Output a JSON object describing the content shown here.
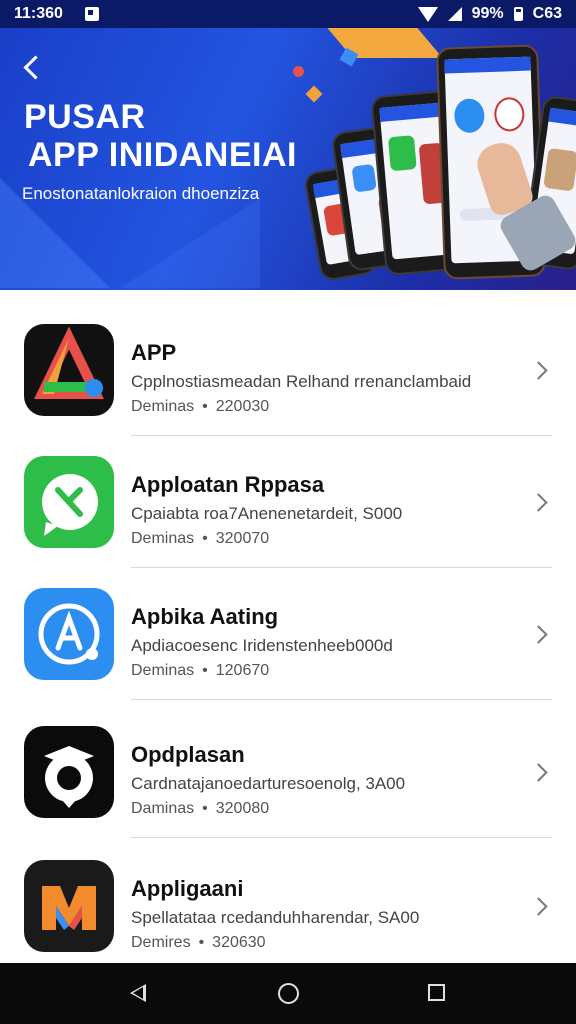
{
  "status_bar": {
    "time": "11:360",
    "battery_percent": "99%",
    "extra": "C63"
  },
  "banner": {
    "title_line1": "PUSAR",
    "title_line2": "APP INIDANEIAI",
    "subtitle": "Enostonatanlokraion dhoenziza"
  },
  "apps": [
    {
      "name": "APP",
      "description": "Cpplnostiasmeadan Relhand rrenanclambaid",
      "meta_label": "Deminas",
      "meta_value": "220030",
      "icon": "triangle-logo-icon",
      "icon_bg": "#111111"
    },
    {
      "name": "Apploatan Rppasa",
      "description": "Cpaiabta roa7Anenenetardeit, S000",
      "meta_label": "Deminas",
      "meta_value": "320070",
      "icon": "chat-bubble-icon",
      "icon_bg": "#2fbd4a"
    },
    {
      "name": "Apbika Aating",
      "description": "Apdiacoesenc Iridenstenheeb000d",
      "meta_label": "Deminas",
      "meta_value": "120670",
      "icon": "app-store-a-icon",
      "icon_bg": "#2b8ef0"
    },
    {
      "name": "Opdplasan",
      "description": "Cardnatajanoedarturesoenolg, 3A00",
      "meta_label": "Daminas",
      "meta_value": "320080",
      "icon": "graduation-owl-icon",
      "icon_bg": "#0b0b0b"
    },
    {
      "name": "Appligaani",
      "description": "Spellatataa rcedanduhharendar, SA00",
      "meta_label": "Demires",
      "meta_value": "320630",
      "icon": "m-logo-icon",
      "icon_bg": "#1a1a1a"
    }
  ],
  "nav": {
    "back_icon": "back-triangle-icon",
    "home_icon": "home-circle-icon",
    "recents_icon": "recents-square-icon"
  },
  "colors": {
    "banner_primary": "#2355e0",
    "status_bar": "#0b1a66",
    "chevron": "#777777"
  }
}
